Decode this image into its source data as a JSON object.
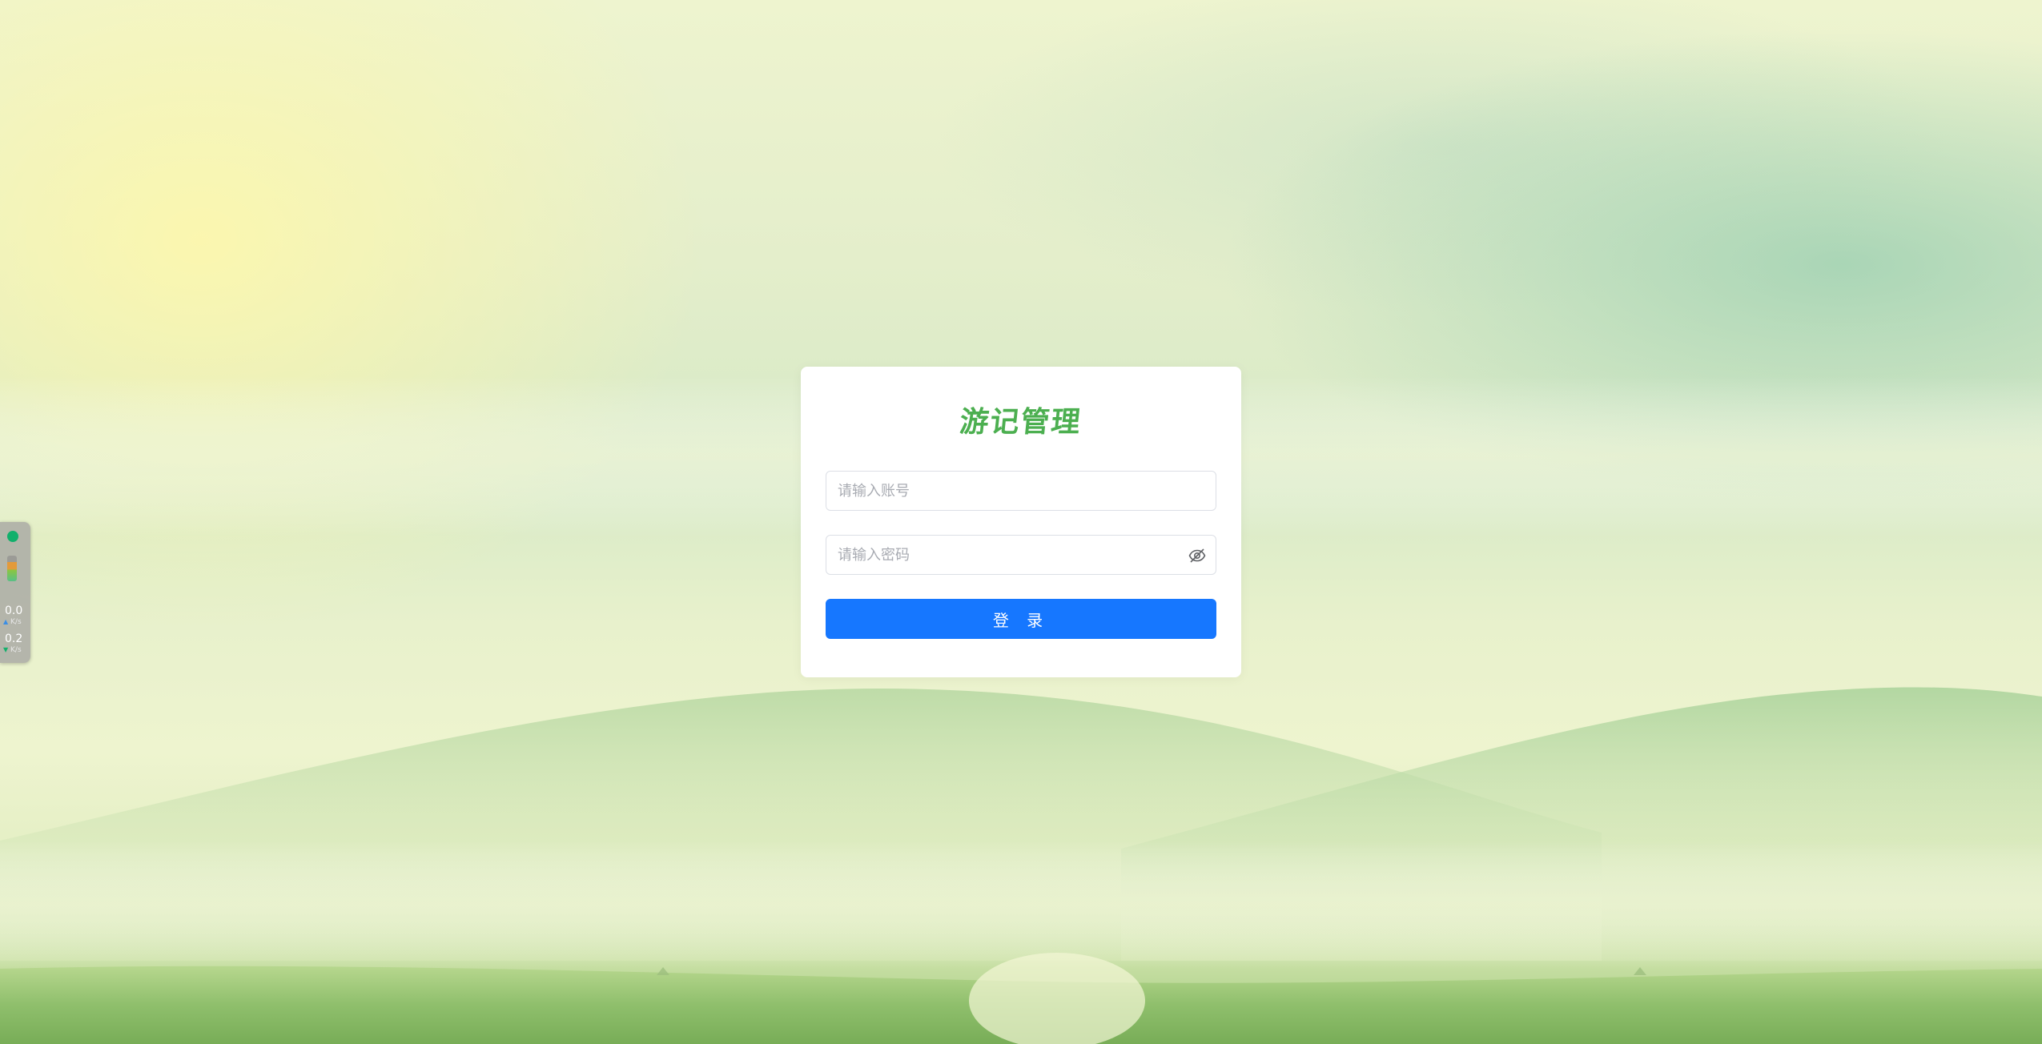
{
  "login": {
    "title": "游记管理",
    "username_placeholder": "请输入账号",
    "password_placeholder": "请输入密码",
    "button_label": "登 录"
  },
  "system_widget": {
    "upload_speed": "0.0",
    "upload_unit": "K/s",
    "download_speed": "0.2",
    "download_unit": "K/s"
  },
  "colors": {
    "title": "#4caf50",
    "button": "#1677ff",
    "status_dot": "#10b06b"
  },
  "icons": {
    "password_toggle": "eye-off-icon"
  }
}
